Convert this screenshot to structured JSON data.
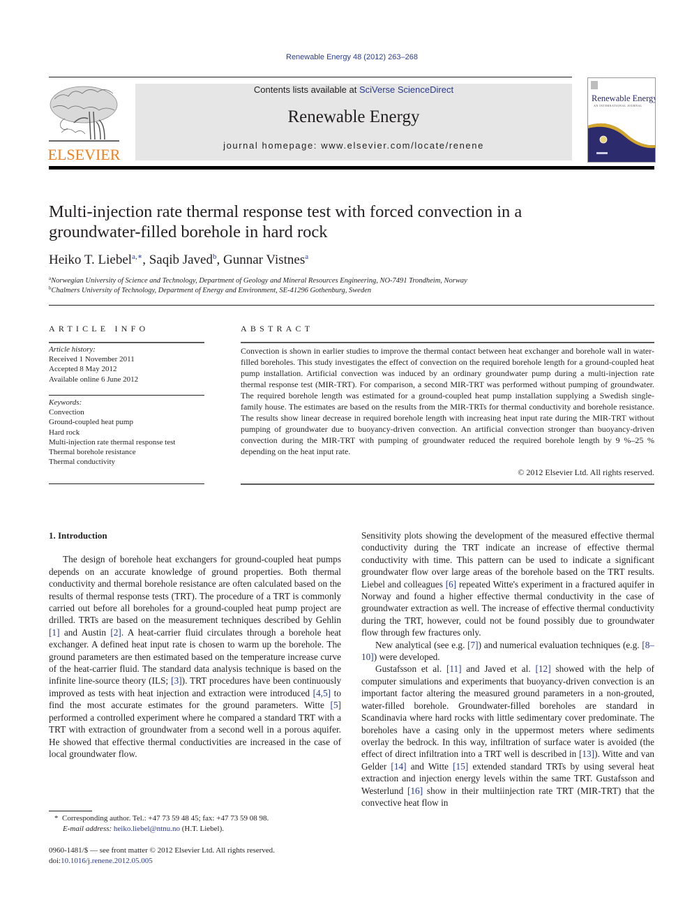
{
  "citation": "Renewable Energy 48 (2012) 263–268",
  "masthead": {
    "publisher_logo_text": "ELSEVIER",
    "contents_prefix": "Contents lists available at ",
    "contents_link": "SciVerse ScienceDirect",
    "journal_name": "Renewable Energy",
    "homepage_prefix": "journal homepage: ",
    "homepage_url": "www.elsevier.com/locate/renene",
    "cover_title": "Renewable Energy",
    "cover_subtitle": "AN INTERNATIONAL JOURNAL",
    "colors": {
      "link": "#2a3b8f",
      "elsevier_orange": "#f07f1c",
      "banner_bg": "#e6e6e6",
      "cover_navy": "#2b2b6e",
      "cover_gold": "#d4a72c"
    }
  },
  "article": {
    "title": "Multi-injection rate thermal response test with forced convection in a groundwater-filled borehole in hard rock",
    "authors": [
      {
        "name": "Heiko T. Liebel",
        "sup": "a,∗"
      },
      {
        "name": "Saqib Javed",
        "sup": "b"
      },
      {
        "name": "Gunnar Vistnes",
        "sup": "a"
      }
    ],
    "affiliations": [
      {
        "sup": "a",
        "text": "Norwegian University of Science and Technology, Department of Geology and Mineral Resources Engineering, NO-7491 Trondheim, Norway"
      },
      {
        "sup": "b",
        "text": "Chalmers University of Technology, Department of Energy and Environment, SE-41296 Gothenburg, Sweden"
      }
    ]
  },
  "article_info": {
    "heading": "ARTICLE INFO",
    "history_label": "Article history:",
    "history": [
      "Received 1 November 2011",
      "Accepted 8 May 2012",
      "Available online 6 June 2012"
    ],
    "keywords_label": "Keywords:",
    "keywords": [
      "Convection",
      "Ground-coupled heat pump",
      "Hard rock",
      "Multi-injection rate thermal response test",
      "Thermal borehole resistance",
      "Thermal conductivity"
    ]
  },
  "abstract": {
    "heading": "ABSTRACT",
    "text": "Convection is shown in earlier studies to improve the thermal contact between heat exchanger and borehole wall in water-filled boreholes. This study investigates the effect of convection on the required borehole length for a ground-coupled heat pump installation. Artificial convection was induced by an ordinary groundwater pump during a multi-injection rate thermal response test (MIR-TRT). For comparison, a second MIR-TRT was performed without pumping of groundwater. The required borehole length was estimated for a ground-coupled heat pump installation supplying a Swedish single-family house. The estimates are based on the results from the MIR-TRTs for thermal conductivity and bore­hole resistance. The results show linear decrease in required borehole length with increasing heat input rate during the MIR-TRT without pumping of groundwater due to buoyancy-driven convection. An artificial convection stronger than buoyancy-driven convection during the MIR-TRT with pumping of groundwater reduced the required borehole length by 9 %–25 % depending on the heat input rate.",
    "copyright": "© 2012 Elsevier Ltd. All rights reserved."
  },
  "body": {
    "section_heading": "1.  Introduction",
    "left_paragraphs": [
      [
        {
          "t": "The design of borehole heat exchangers for ground-coupled heat pumps depends on an accurate knowledge of ground prop­erties. Both thermal conductivity and thermal borehole resistance are often calculated based on the results of thermal response tests (TRT). The procedure of a TRT is commonly carried out before all boreholes for a ground-coupled heat pump project are drilled. TRTs are based on the measurement techniques described by Gehlin "
        },
        {
          "ref": "[1]"
        },
        {
          "t": " and Austin "
        },
        {
          "ref": "[2]"
        },
        {
          "t": ". A heat-carrier fluid circulates through a borehole heat exchanger. A defined heat input rate is chosen to warm up the borehole. The ground parameters are then estimated based on the temperature increase curve of the heat-carrier fluid. The standard data analysis technique is based on the infinite line-source theory (ILS; "
        },
        {
          "ref": "[3]"
        },
        {
          "t": "). TRT procedures have been continuously improved as tests with heat injection and extraction were introduced "
        },
        {
          "ref": "[4,5]"
        },
        {
          "t": " to find the most accurate estimates for the ground parameters. Witte "
        },
        {
          "ref": "[5]"
        },
        {
          "t": " performed a controlled experiment where he compared a stan­dard TRT with a TRT with extraction of groundwater from a second well in a porous aquifer. He showed that effective thermal conductivities are increased in the case of local groundwater flow."
        }
      ]
    ],
    "right_paragraphs": [
      [
        {
          "t": "Sensitivity plots showing the development of the measured effec­tive thermal conductivity during the TRT indicate an increase of effective thermal conductivity with time. This pattern can be used to indicate a significant groundwater flow over large areas of the borehole based on the TRT results. Liebel and colleagues "
        },
        {
          "ref": "[6]"
        },
        {
          "t": " repeated Witte's experiment in a fractured aquifer in Norway and found a higher effective thermal conductivity in the case of groundwater extraction as well. The increase of effective thermal conductivity during the TRT, however, could not be found possibly due to groundwater flow through few fractures only."
        }
      ],
      [
        {
          "t": "New analytical (see e.g. "
        },
        {
          "ref": "[7]"
        },
        {
          "t": ") and numerical evaluation tech­niques (e.g. "
        },
        {
          "ref": "[8–10]"
        },
        {
          "t": ") were developed."
        }
      ],
      [
        {
          "t": "Gustafsson et al. "
        },
        {
          "ref": "[11]"
        },
        {
          "t": " and Javed et al. "
        },
        {
          "ref": "[12]"
        },
        {
          "t": " showed with the help of computer simulations and experiments that buoyancy-driven convection is an important factor altering the measured ground parameters in a non-grouted, water-filled borehole. Groundwater-filled boreholes are standard in Scandinavia where hard rocks with little sedimentary cover predominate. The boreholes have a casing only in the uppermost meters where sediments overlay the bedrock. In this way, infiltration of surface water is avoided (the effect of direct infiltration into a TRT well is described in "
        },
        {
          "ref": "[13]"
        },
        {
          "t": "). Witte and van Gelder "
        },
        {
          "ref": "[14]"
        },
        {
          "t": " and Witte "
        },
        {
          "ref": "[15]"
        },
        {
          "t": " extended standard TRTs by using several heat extraction and injection energy levels within the same TRT. Gustafsson and Westerlund "
        },
        {
          "ref": "[16]"
        },
        {
          "t": " show in their multi­injection rate TRT (MIR-TRT) that the convective heat flow in"
        }
      ]
    ]
  },
  "footnote": {
    "marker": "*",
    "corresponding": "Corresponding author. Tel.: +47 73 59 48 45; fax: +47 73 59 08 98.",
    "email_label": "E-mail address:",
    "email": "heiko.liebel@ntnu.no",
    "email_suffix": " (H.T. Liebel)."
  },
  "issn_line": "0960-1481/$ — see front matter © 2012 Elsevier Ltd. All rights reserved.",
  "doi_label": "doi:",
  "doi": "10.1016/j.renene.2012.05.005"
}
